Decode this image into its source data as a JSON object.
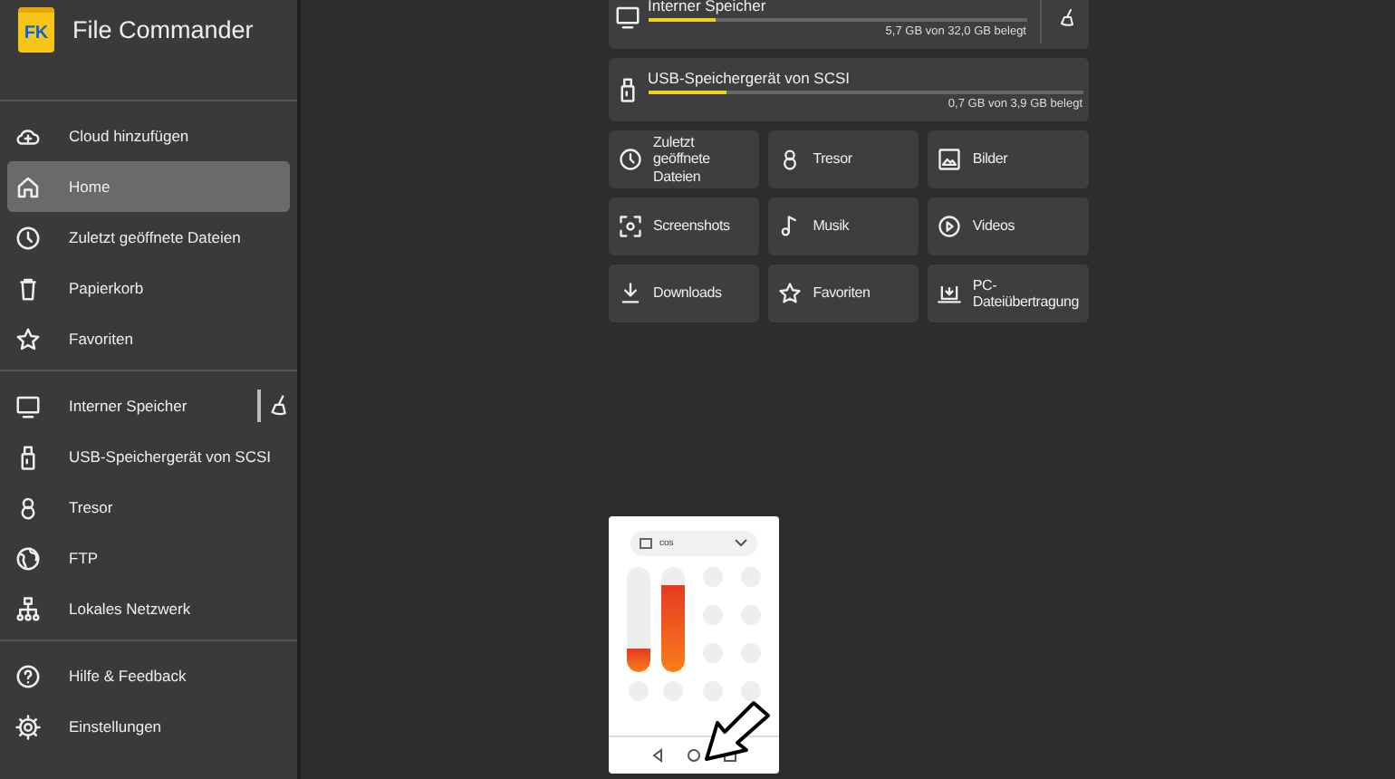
{
  "app": {
    "title": "File Commander",
    "logo": "FK"
  },
  "sidebar": {
    "groups": [
      [
        {
          "label": "Cloud hinzufügen",
          "selected": false
        },
        {
          "label": "Home",
          "selected": true
        },
        {
          "label": "Zuletzt geöffnete Dateien",
          "selected": false
        },
        {
          "label": "Papierkorb",
          "selected": false
        },
        {
          "label": "Favoriten",
          "selected": false
        }
      ],
      [
        {
          "label": "Interner Speicher",
          "selected": false
        },
        {
          "label": "USB-Speichergerät von SCSI",
          "selected": false
        },
        {
          "label": "Tresor",
          "selected": false
        },
        {
          "label": "FTP",
          "selected": false
        },
        {
          "label": "Lokales Netzwerk",
          "selected": false
        }
      ],
      [
        {
          "label": "Hilfe & Feedback",
          "selected": false
        },
        {
          "label": "Einstellungen",
          "selected": false
        }
      ]
    ]
  },
  "storage": [
    {
      "name": "Interner Speicher",
      "level": 0.18,
      "usage": "5,7 GB von 32,0 GB belegt"
    },
    {
      "name": "USB-Speichergerät von SCSI",
      "level": 0.18,
      "usage": "0,7 GB von 3,9 GB belegt"
    }
  ],
  "tiles": [
    "Zuletzt geöffnete Dateien",
    "Tresor",
    "Bilder",
    "Screenshots",
    "Musik",
    "Videos",
    "Downloads",
    "Favoriten",
    "PC-Dateiübertragung"
  ],
  "phone": {
    "dropdown": "cos",
    "sliders": [
      {
        "level": 0.22
      },
      {
        "level": 0.82
      }
    ]
  }
}
